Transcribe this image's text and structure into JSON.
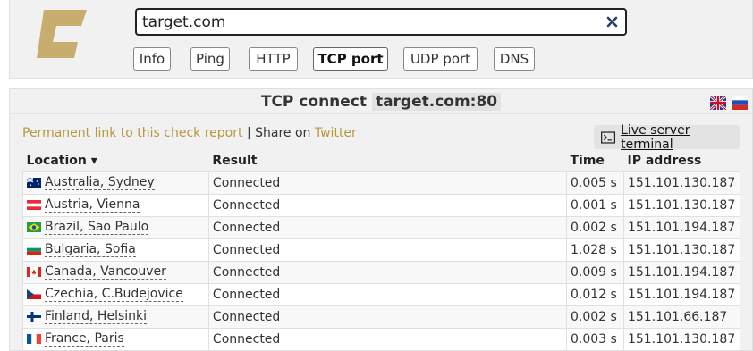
{
  "search": {
    "value": "target.com"
  },
  "tabs": [
    {
      "label": "Info"
    },
    {
      "label": "Ping"
    },
    {
      "label": "HTTP"
    },
    {
      "label": "TCP port"
    },
    {
      "label": "UDP port"
    },
    {
      "label": "DNS"
    }
  ],
  "active_tab": "TCP port",
  "report": {
    "title_prefix": "TCP connect",
    "title_host": "target.com:80",
    "permanent_link": "Permanent link to this check report",
    "share_separator": "| Share on",
    "twitter": "Twitter",
    "terminal_button": "Live server terminal"
  },
  "table": {
    "headers": {
      "location": "Location ▾",
      "result": "Result",
      "time": "Time",
      "ip": "IP address"
    },
    "rows": [
      {
        "location": "Australia, Sydney",
        "result": "Connected",
        "time": "0.005 s",
        "ip": "151.101.130.187",
        "flag": "au"
      },
      {
        "location": "Austria, Vienna",
        "result": "Connected",
        "time": "0.001 s",
        "ip": "151.101.130.187",
        "flag": "at"
      },
      {
        "location": "Brazil, Sao Paulo",
        "result": "Connected",
        "time": "0.002 s",
        "ip": "151.101.194.187",
        "flag": "br"
      },
      {
        "location": "Bulgaria, Sofia",
        "result": "Connected",
        "time": "1.028 s",
        "ip": "151.101.130.187",
        "flag": "bg"
      },
      {
        "location": "Canada, Vancouver",
        "result": "Connected",
        "time": "0.009 s",
        "ip": "151.101.194.187",
        "flag": "ca"
      },
      {
        "location": "Czechia, C.Budejovice",
        "result": "Connected",
        "time": "0.012 s",
        "ip": "151.101.194.187",
        "flag": "cz"
      },
      {
        "location": "Finland, Helsinki",
        "result": "Connected",
        "time": "0.002 s",
        "ip": "151.101.66.187",
        "flag": "fi"
      },
      {
        "location": "France, Paris",
        "result": "Connected",
        "time": "0.003 s",
        "ip": "151.101.130.187",
        "flag": "fr"
      }
    ]
  },
  "colors": {
    "accent": "#b8963e",
    "logo": "#c8ae6e",
    "panel_bg": "#f1f1f1"
  },
  "icons": {
    "clear": "close-icon",
    "terminal": "terminal-icon",
    "lang_en": "uk-flag-icon",
    "lang_ru": "russia-flag-icon"
  }
}
